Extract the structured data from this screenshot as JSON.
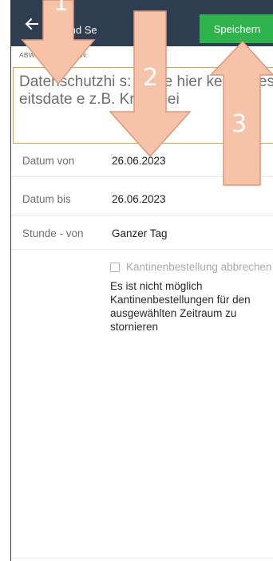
{
  "appbar": {
    "title": "pielkind Se",
    "save_label": "Speichern",
    "bg": "#2d3e50",
    "save_color": "#2eb34d"
  },
  "note": {
    "label": "ABW          TSNOTIZ H           EN:",
    "text": "Datenschutzhi        s: Gebe hier keine Ges          eitsdate       e z.B. Krankhei",
    "border_color": "#e0a43a"
  },
  "fields": [
    {
      "label": "Datum von",
      "value": "26.06.2023"
    },
    {
      "label": "Datum bis",
      "value": "26.06.2023"
    },
    {
      "label": "Stunde - von",
      "value": "Ganzer Tag"
    }
  ],
  "cancel": {
    "label": "Kantinenbestellung abbrechen",
    "checked": false,
    "info": "Es ist nicht möglich Kantinenbestellungen für den ausgewählten Zeitraum zu stornieren"
  },
  "annotations": {
    "color": "#f7c3a8",
    "labels": [
      "1",
      "2",
      "3"
    ]
  }
}
